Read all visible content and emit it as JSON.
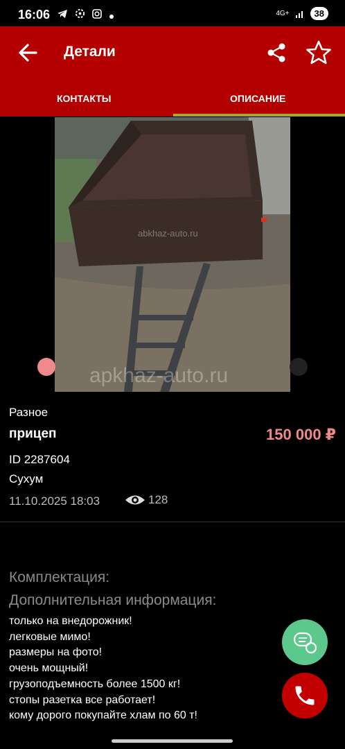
{
  "status_bar": {
    "time": "16:06",
    "network": "4G+",
    "battery": "38"
  },
  "header": {
    "title": "Детали",
    "back_icon": "arrow-left-icon",
    "share_icon": "share-icon",
    "favorite_icon": "star-outline-icon",
    "tabs": [
      {
        "label": "КОНТАКТЫ",
        "selected": false
      },
      {
        "label": "ОПИСАНИЕ",
        "selected": true
      }
    ]
  },
  "colors": {
    "header_bg": "#b40000",
    "price": "#f08a8a",
    "tab_indicator": "#a8a830",
    "chat_fab": "#5cc88b",
    "call_fab": "#c30000"
  },
  "gallery": {
    "watermark_small": "abkhaz-auto.ru",
    "watermark_large": "apkhaz-auto.ru"
  },
  "listing": {
    "category": "Разное",
    "name": "прицеп",
    "price": "150 000 ₽",
    "id": "ID 2287604",
    "city": "Сухум",
    "date": "11.10.2025 18:03",
    "views": "128"
  },
  "description": {
    "equipment_title": "Комплектация:",
    "extra_title": "Дополнительная информация:",
    "lines": [
      "только на внедорожник!",
      "легковые мимо!",
      "размеры на фото!",
      "очень мощный!",
      "грузоподъемность более 1500 кг!",
      "стопы разетка все работает!",
      "кому дорого покупайте хлам по 60 т!"
    ]
  },
  "fabs": {
    "chat_icon": "chat-icon",
    "call_icon": "phone-icon"
  }
}
